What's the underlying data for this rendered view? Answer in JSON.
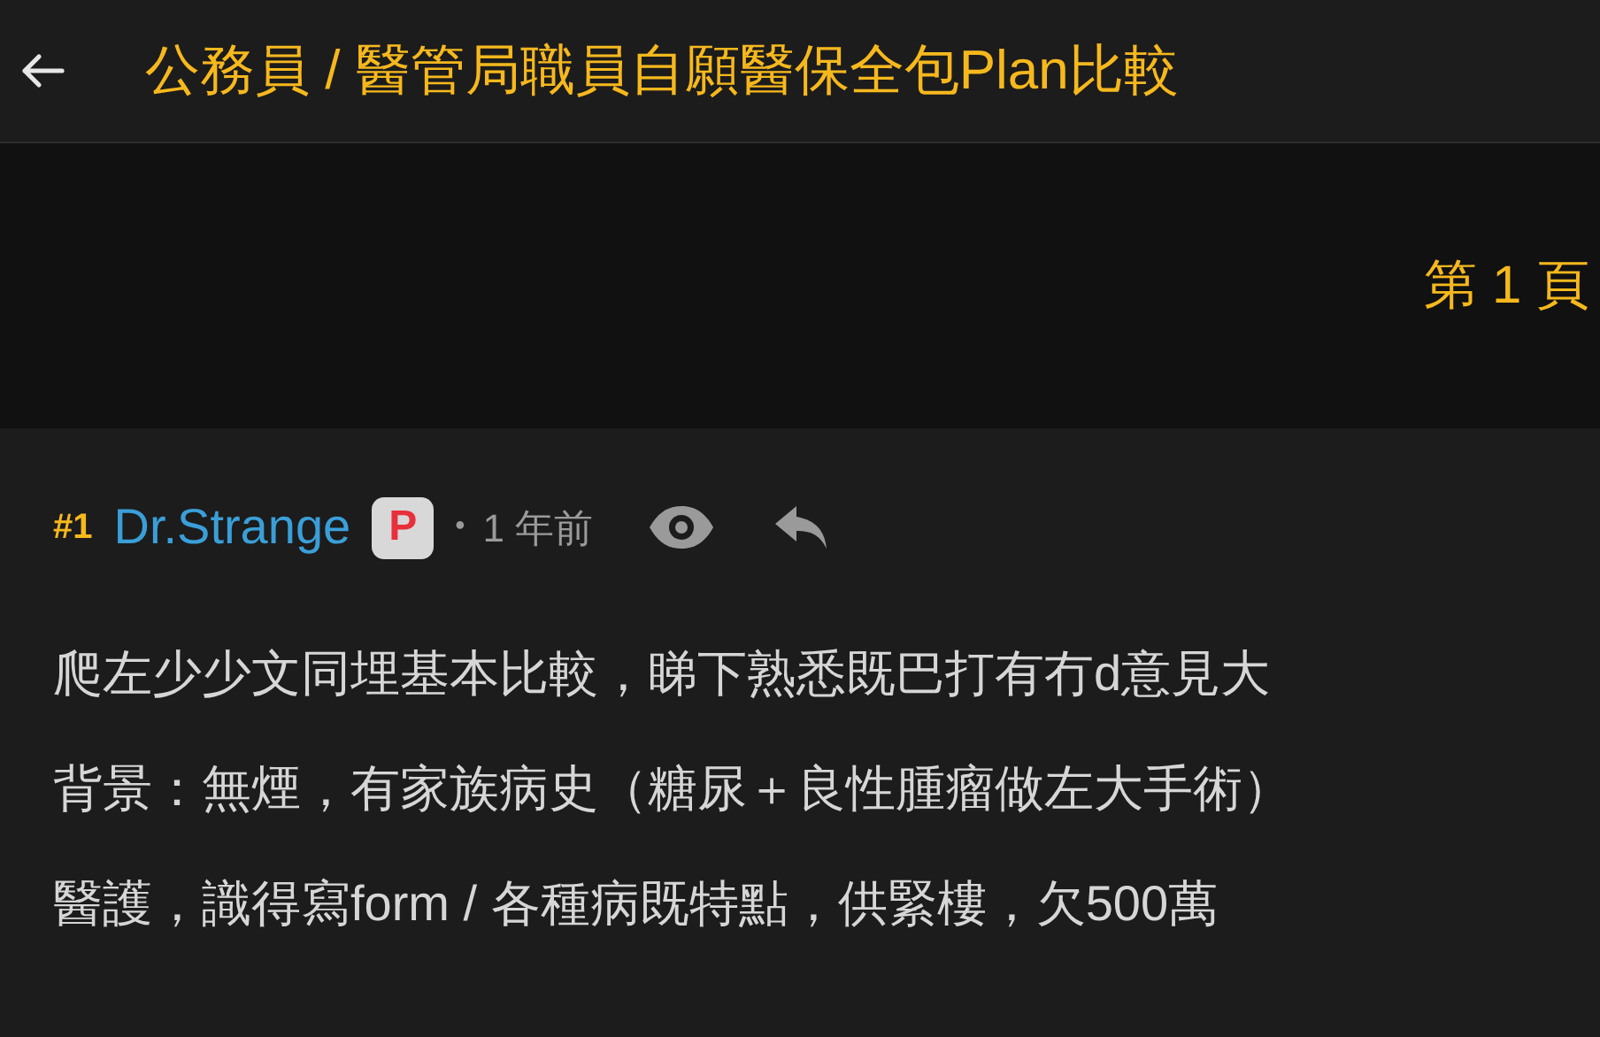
{
  "header": {
    "title": "公務員 / 醫管局職員自願醫保全包Plan比較"
  },
  "page_label": "第 1 頁",
  "post": {
    "number": "#1",
    "author": "Dr.Strange",
    "badge": "P",
    "separator": "•",
    "time": "1 年前",
    "lines": [
      "爬左少少文同埋基本比較，睇下熟悉既巴打有冇d意見大",
      "背景：無煙，有家族病史（糖尿＋良性腫瘤做左大手術）",
      "醫護，識得寫form / 各種病既特點，供緊樓，欠500萬"
    ]
  }
}
